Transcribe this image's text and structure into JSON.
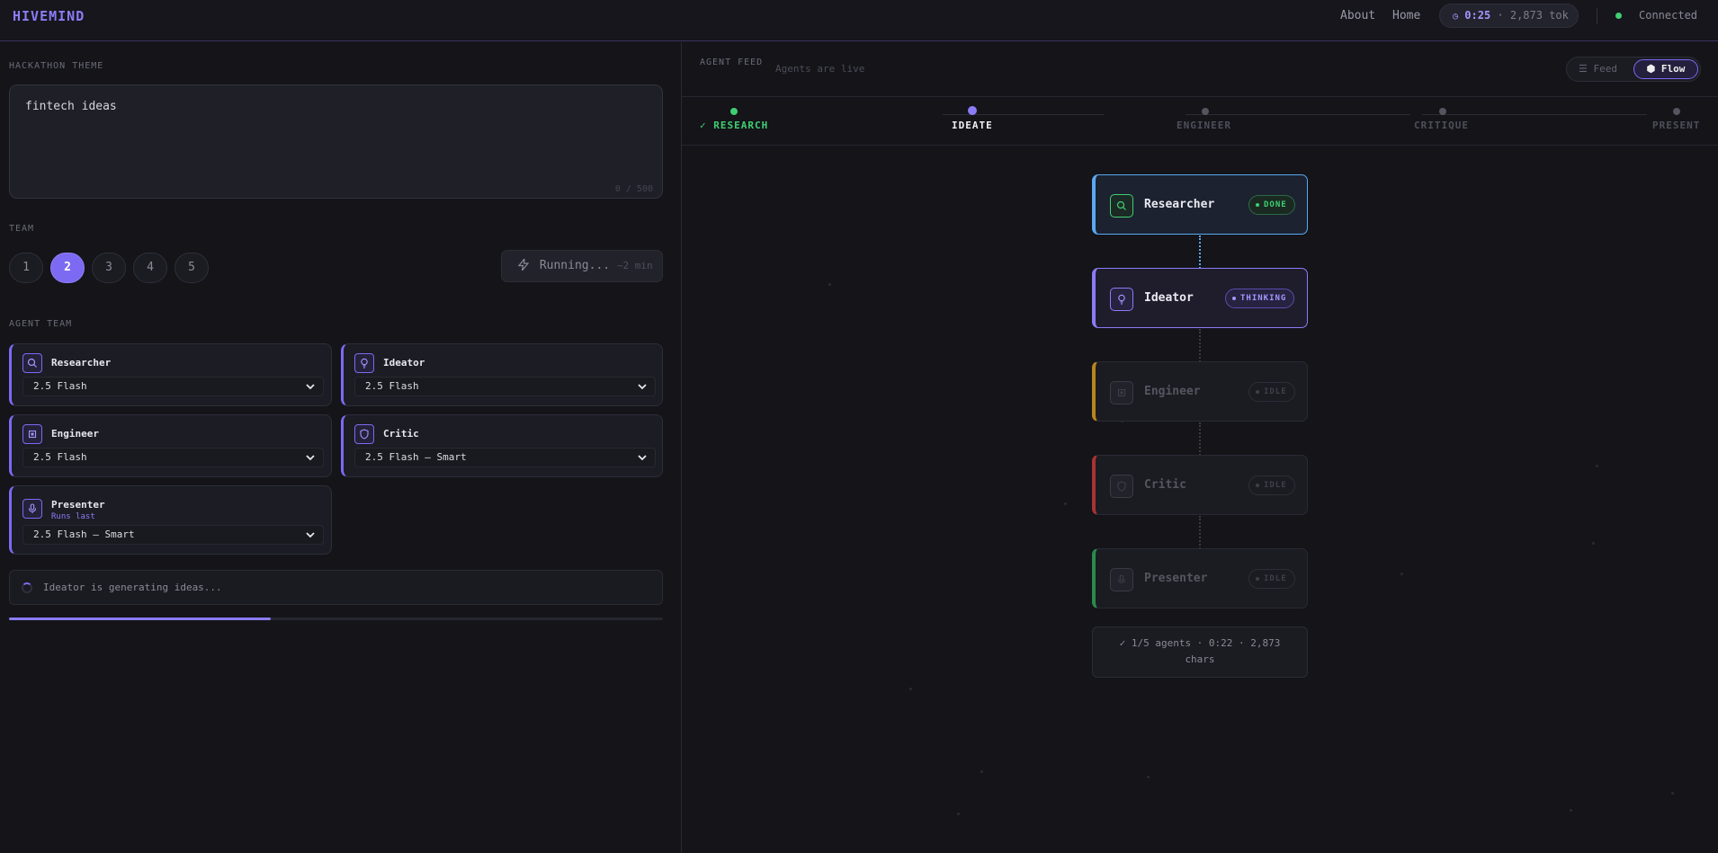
{
  "app": {
    "logo": "HIVEMIND"
  },
  "nav": {
    "about": "About",
    "home": "Home",
    "timer": "0:25",
    "tokens": "2,873 tok",
    "connection": "Connected"
  },
  "theme": {
    "label": "HACKATHON THEME",
    "value": "fintech ideas",
    "char_count": "0 / 500"
  },
  "team": {
    "label": "TEAM",
    "options": [
      "1",
      "2",
      "3",
      "4",
      "5"
    ],
    "selected": "2",
    "run_label": "Running...",
    "run_estimate": "~2 min"
  },
  "agent_team": {
    "label": "AGENT TEAM",
    "agents": [
      {
        "name": "Researcher",
        "model": "2.5 Flash"
      },
      {
        "name": "Ideator",
        "model": "2.5 Flash"
      },
      {
        "name": "Engineer",
        "model": "2.5 Flash"
      },
      {
        "name": "Critic",
        "model": "2.5 Flash — Smart"
      },
      {
        "name": "Presenter",
        "sub": "Runs last",
        "model": "2.5 Flash — Smart"
      }
    ]
  },
  "status": {
    "text": "Ideator is generating ideas...",
    "progress": 0.4
  },
  "feed": {
    "label": "AGENT FEED",
    "subtitle": "Agents are live",
    "toggle_feed": "Feed",
    "toggle_flow": "Flow",
    "stages": [
      {
        "label": "RESEARCH",
        "state": "done"
      },
      {
        "label": "IDEATE",
        "state": "active"
      },
      {
        "label": "ENGINEER",
        "state": "idle"
      },
      {
        "label": "CRITIQUE",
        "state": "idle"
      },
      {
        "label": "PRESENT",
        "state": "idle"
      }
    ],
    "nodes": [
      {
        "name": "Researcher",
        "status": "DONE"
      },
      {
        "name": "Ideator",
        "status": "THINKING"
      },
      {
        "name": "Engineer",
        "status": "IDLE"
      },
      {
        "name": "Critic",
        "status": "IDLE"
      },
      {
        "name": "Presenter",
        "status": "IDLE"
      }
    ],
    "summary_line1": "✓ 1/5 agents · 0:22 · 2,873",
    "summary_line2": "chars"
  },
  "colors": {
    "accent": "#7c6af2",
    "done": "#3fcf72",
    "researcher": "#5aa9f0",
    "engineer": "#d79a2a",
    "critic": "#c43b3b",
    "presenter": "#2f9d55"
  }
}
